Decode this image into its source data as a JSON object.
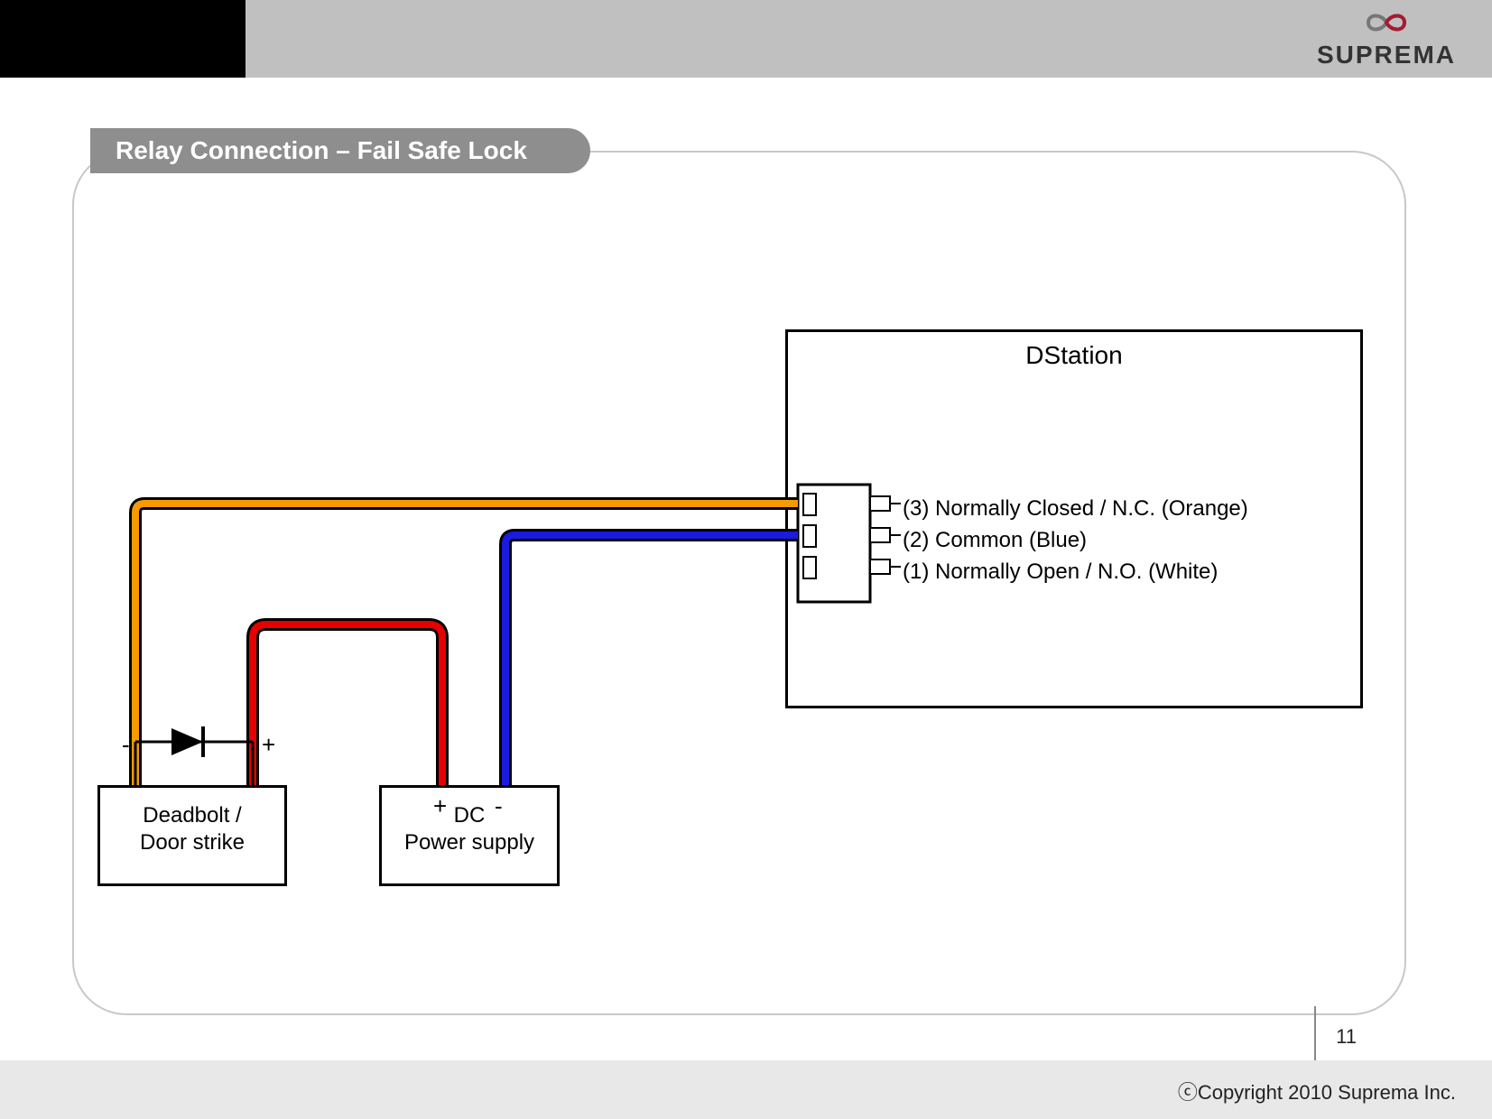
{
  "brand": "SUPREMA",
  "title": "Relay Connection – Fail Safe Lock",
  "device_label": "DStation",
  "pins": {
    "p3": "(3) Normally Closed / N.C. (Orange)",
    "p2": "(2) Common (Blue)",
    "p1": "(1) Normally Open / N.O. (White)"
  },
  "lock": {
    "line1": "Deadbolt /",
    "line2": "Door strike",
    "neg": "-",
    "pos": "+"
  },
  "dc": {
    "line1": "DC",
    "line2": "Power supply",
    "pos": "+",
    "neg": "-"
  },
  "copyright": "ⓒCopyright 2010 Suprema Inc.",
  "page_number": "11",
  "chart_data": {
    "type": "wiring-diagram",
    "title": "Relay Connection – Fail Safe Lock",
    "components": [
      {
        "id": "dstation",
        "label": "DStation",
        "pins": [
          {
            "num": 3,
            "name": "Normally Closed / N.C.",
            "color": "Orange"
          },
          {
            "num": 2,
            "name": "Common",
            "color": "Blue"
          },
          {
            "num": 1,
            "name": "Normally Open / N.O.",
            "color": "White"
          }
        ]
      },
      {
        "id": "lock",
        "label": "Deadbolt / Door strike",
        "terminals": [
          "-",
          "+"
        ]
      },
      {
        "id": "dc",
        "label": "DC Power supply",
        "terminals": [
          "+",
          "-"
        ]
      },
      {
        "id": "diode",
        "type": "diode",
        "between": [
          "lock.-",
          "lock.+"
        ]
      }
    ],
    "wires": [
      {
        "color": "orange",
        "from": "dstation.pin3_NC",
        "to": "lock.-"
      },
      {
        "color": "blue",
        "from": "dstation.pin2_COM",
        "to": "dc.-"
      },
      {
        "color": "red",
        "from": "dc.+",
        "to": "lock.+"
      }
    ]
  }
}
